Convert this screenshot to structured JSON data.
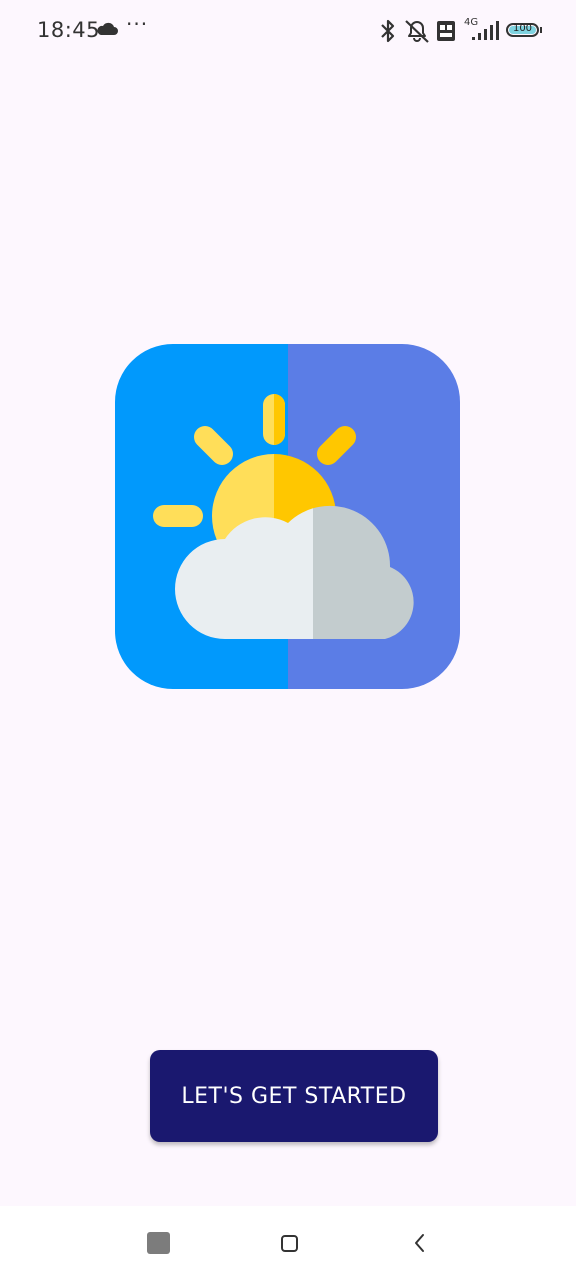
{
  "status_bar": {
    "time": "18:45",
    "more": "···",
    "network_label": "4G",
    "battery_level": "100"
  },
  "logo": {
    "name": "partly-cloudy-weather-icon",
    "colors": {
      "left_bg": "#0199fc",
      "right_bg": "#5b7de6",
      "sun_light": "#ffde59",
      "sun_dark": "#ffc700",
      "cloud_light": "#e9eef1",
      "cloud_dark": "#c3ccce"
    }
  },
  "button": {
    "label": "LET'S GET STARTED",
    "color": "#1a186f"
  },
  "nav_bar": {
    "icons": [
      "recent-apps-icon",
      "home-icon",
      "back-icon"
    ]
  }
}
